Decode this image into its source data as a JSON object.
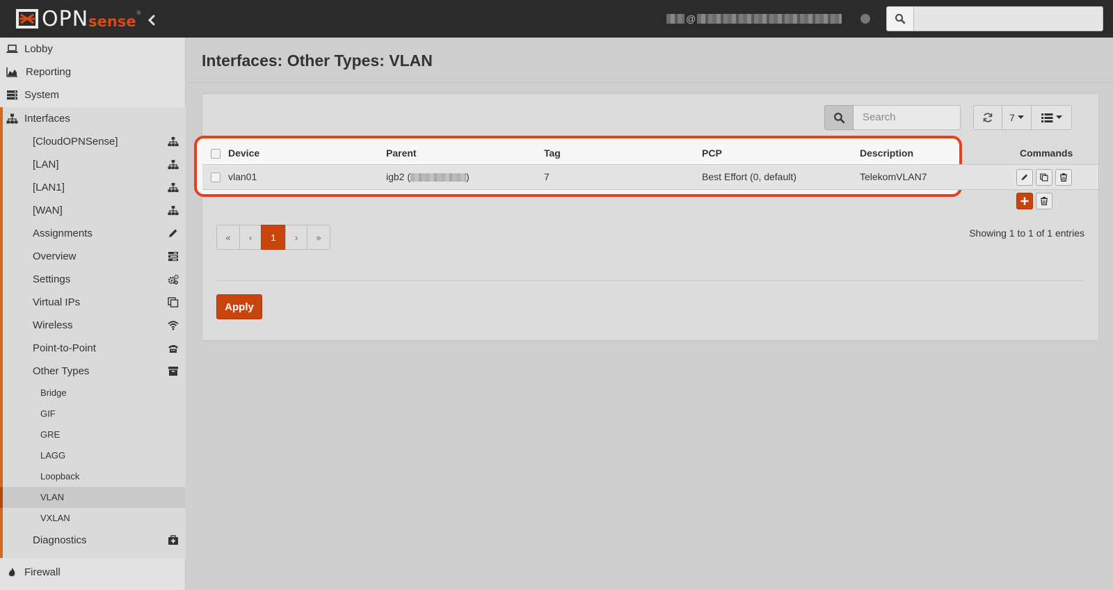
{
  "brand": {
    "logo_text": "OPN",
    "logo_accent": "sense",
    "logo_reg": "®"
  },
  "header": {
    "user_at": "@",
    "search_placeholder": ""
  },
  "sidebar": {
    "top": [
      {
        "label": "Lobby",
        "icon": "laptop-icon"
      },
      {
        "label": "Reporting",
        "icon": "area-chart-icon"
      },
      {
        "label": "System",
        "icon": "server-icon"
      },
      {
        "label": "Interfaces",
        "icon": "sitemap-icon"
      }
    ],
    "interfaces_items": [
      {
        "label": "[CloudOPNSense]",
        "icon": "sitemap-icon"
      },
      {
        "label": "[LAN]",
        "icon": "sitemap-icon"
      },
      {
        "label": "[LAN1]",
        "icon": "sitemap-icon"
      },
      {
        "label": "[WAN]",
        "icon": "sitemap-icon"
      },
      {
        "label": "Assignments",
        "icon": "pencil-icon"
      },
      {
        "label": "Overview",
        "icon": "tasks-icon"
      },
      {
        "label": "Settings",
        "icon": "cogs-icon"
      },
      {
        "label": "Virtual IPs",
        "icon": "clone-icon"
      },
      {
        "label": "Wireless",
        "icon": "wifi-icon"
      },
      {
        "label": "Point-to-Point",
        "icon": "fax-icon"
      },
      {
        "label": "Other Types",
        "icon": "archive-icon"
      }
    ],
    "other_types": [
      "Bridge",
      "GIF",
      "GRE",
      "LAGG",
      "Loopback",
      "VLAN",
      "VXLAN"
    ],
    "diagnostics": {
      "label": "Diagnostics",
      "icon": "medkit-icon"
    },
    "firewall": {
      "label": "Firewall",
      "icon": "fire-icon"
    }
  },
  "page": {
    "title": "Interfaces: Other Types: VLAN",
    "search_placeholder": "Search",
    "rows_per_page": "7",
    "columns": [
      "Device",
      "Parent",
      "Tag",
      "PCP",
      "Description",
      "Commands"
    ],
    "rows": [
      {
        "device": "vlan01",
        "parent_prefix": "igb2 (",
        "parent_suffix": ")",
        "tag": "7",
        "pcp": "Best Effort (0, default)",
        "description": "TelekomVLAN7"
      }
    ],
    "pager": [
      "«",
      "‹",
      "1",
      "›",
      "»"
    ],
    "entries_text": "Showing 1 to 1 of 1 entries",
    "apply_label": "Apply"
  },
  "colors": {
    "accent": "#c9440d",
    "highlight": "#e8401f",
    "topbar": "#2b2b2b",
    "sidebar_bar": "#d2691e"
  }
}
